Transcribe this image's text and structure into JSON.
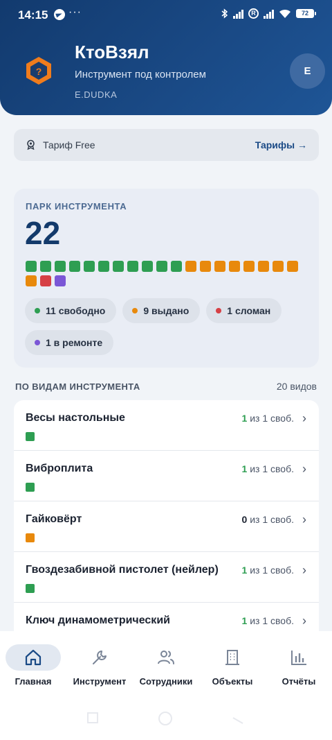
{
  "statusbar": {
    "time": "14:15",
    "dots": "···",
    "battery": "72"
  },
  "app": {
    "title": "КтоВзял",
    "subtitle": "Инструмент под контролем",
    "user": "E.DUDKA",
    "avatar_letter": "E"
  },
  "tariff": {
    "label": "Тариф Free",
    "link": "Тарифы →"
  },
  "colors": {
    "free": "#2e9e52",
    "issued": "#e8890c",
    "broken": "#d64045",
    "repair": "#7b57d6",
    "brand": "#1a4a86"
  },
  "park": {
    "label": "ПАРК ИНСТРУМЕНТА",
    "total": "22",
    "squares": [
      "free",
      "free",
      "free",
      "free",
      "free",
      "free",
      "free",
      "free",
      "free",
      "free",
      "free",
      "issued",
      "issued",
      "issued",
      "issued",
      "issued",
      "issued",
      "issued",
      "issued",
      "issued",
      "broken",
      "repair"
    ],
    "pills": [
      {
        "status": "free",
        "text": "11 свободно"
      },
      {
        "status": "issued",
        "text": "9 выдано"
      },
      {
        "status": "broken",
        "text": "1 сломан"
      },
      {
        "status": "repair",
        "text": "1 в ремонте"
      }
    ]
  },
  "types": {
    "heading": "ПО ВИДАМ ИНСТРУМЕНТА",
    "count": "20 видов",
    "rows": [
      {
        "name": "Весы настольные",
        "free": "1",
        "rest": " из 1 своб.",
        "status": "free"
      },
      {
        "name": "Виброплита",
        "free": "1",
        "rest": " из 1 своб.",
        "status": "free"
      },
      {
        "name": "Гайковёрт",
        "free": "0",
        "rest": " из 1 своб.",
        "status": "issued"
      },
      {
        "name": "Гвоздезабивной пистолет (нейлер)",
        "free": "1",
        "rest": " из 1 своб.",
        "status": "free"
      },
      {
        "name": "Ключ динамометрический",
        "free": "1",
        "rest": " из 1 своб.",
        "status": "free"
      }
    ]
  },
  "nav": {
    "items": [
      {
        "label": "Главная",
        "icon": "home-icon",
        "active": true
      },
      {
        "label": "Инструмент",
        "icon": "wrench-icon",
        "active": false
      },
      {
        "label": "Сотрудники",
        "icon": "people-icon",
        "active": false
      },
      {
        "label": "Объекты",
        "icon": "building-icon",
        "active": false
      },
      {
        "label": "Отчёты",
        "icon": "chart-icon",
        "active": false
      }
    ]
  }
}
